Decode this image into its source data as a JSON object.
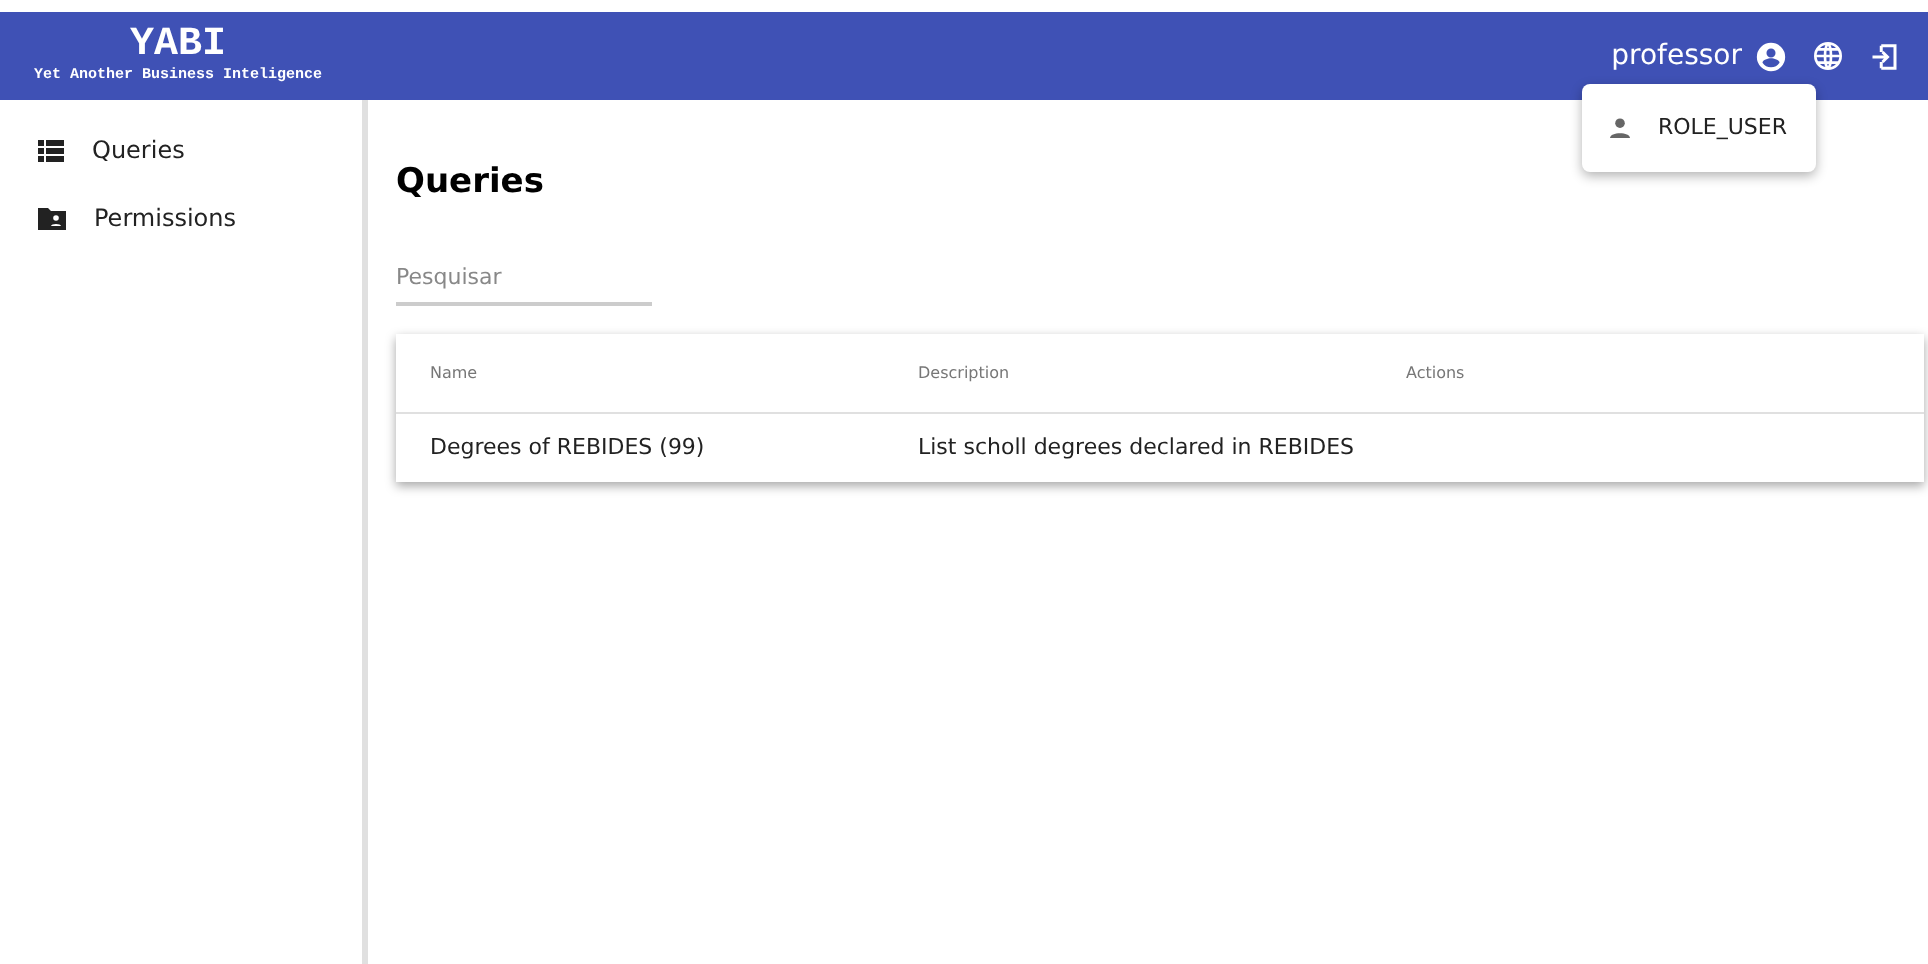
{
  "app": {
    "title": "YABI",
    "subtitle": "Yet Another Business Inteligence"
  },
  "user": {
    "name": "professor"
  },
  "user_menu": {
    "items": [
      "ROLE_USER"
    ]
  },
  "sidebar": {
    "items": [
      {
        "label": "Queries"
      },
      {
        "label": "Permissions"
      }
    ]
  },
  "page": {
    "title": "Queries"
  },
  "search": {
    "placeholder": "Pesquisar"
  },
  "table": {
    "columns": [
      "Name",
      "Description",
      "Actions"
    ],
    "rows": [
      [
        "Degrees of REBIDES (99)",
        "List scholl degrees declared in REBIDES",
        ""
      ]
    ]
  }
}
